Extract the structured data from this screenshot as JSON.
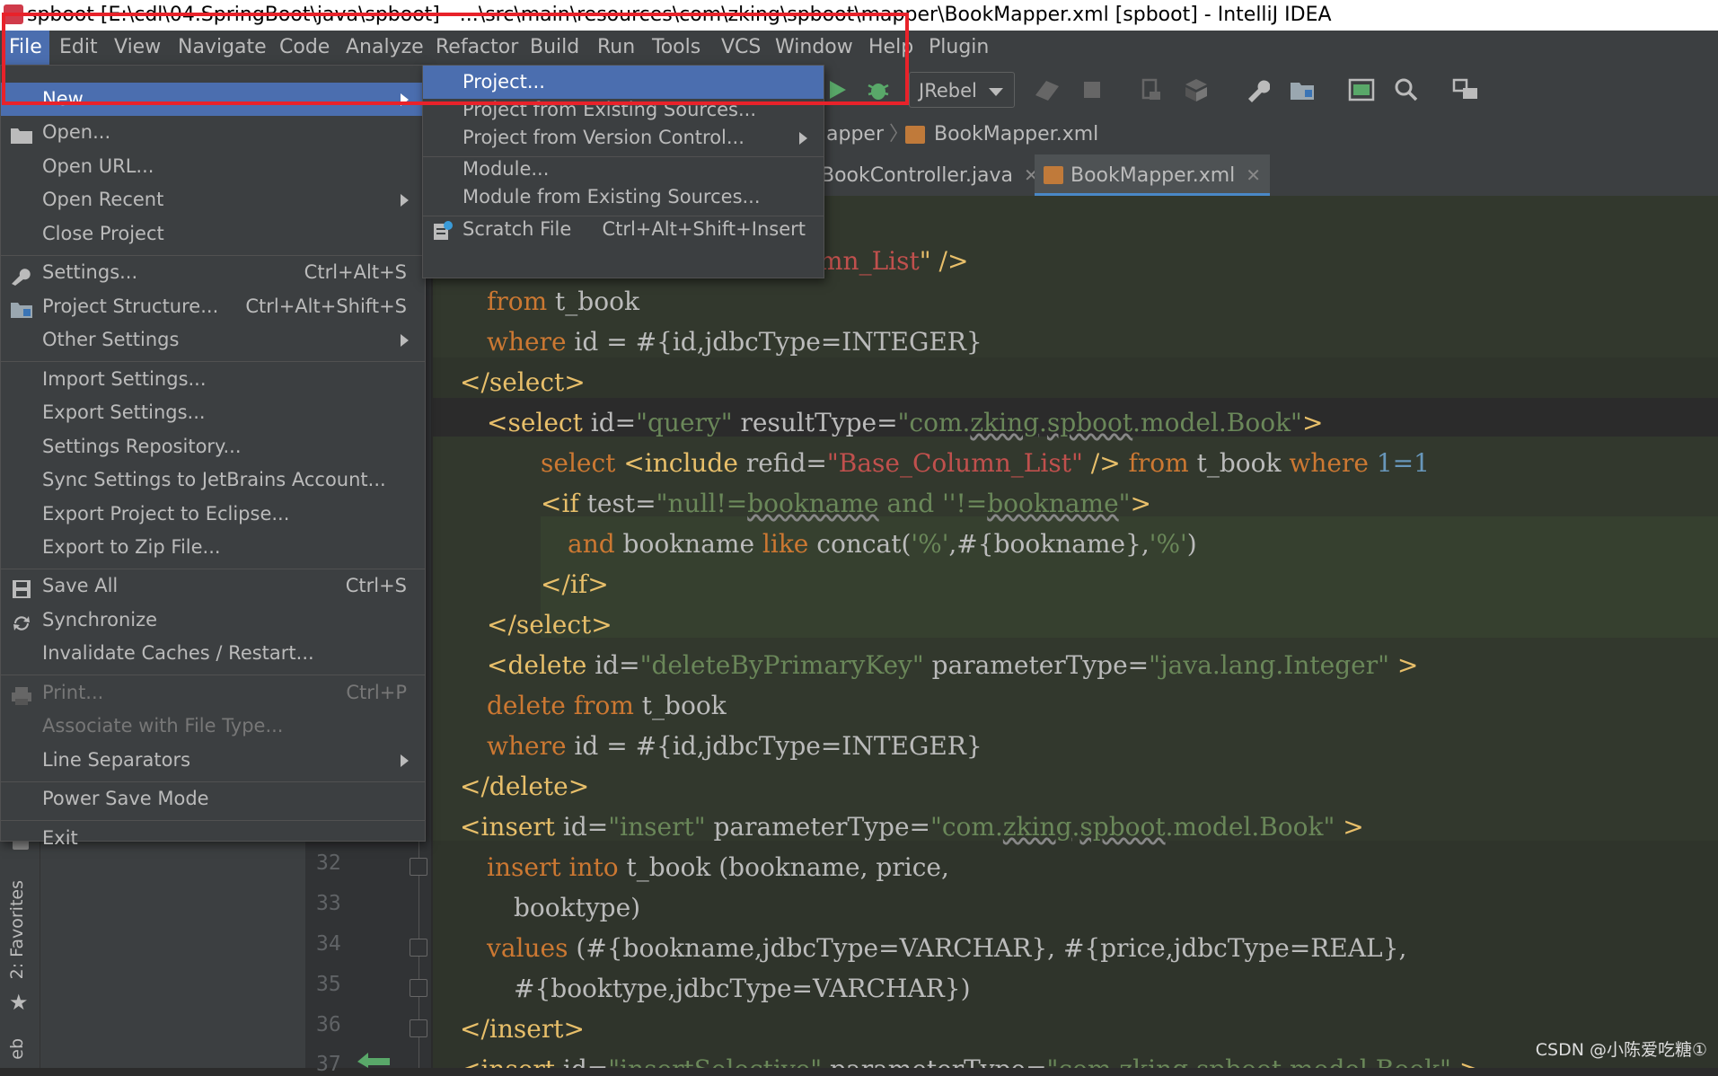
{
  "window": {
    "title": "spboot [E:\\cdl\\04.SpringBoot\\java\\spboot] - ...\\src\\main\\resources\\com\\zking\\spboot\\mapper\\BookMapper.xml [spboot] - IntelliJ IDEA"
  },
  "menubar": {
    "items": [
      "File",
      "Edit",
      "View",
      "Navigate",
      "Code",
      "Analyze",
      "Refactor",
      "Build",
      "Run",
      "Tools",
      "VCS",
      "Window",
      "Help",
      "Plugin"
    ]
  },
  "toolbar": {
    "run_config": "JRebel"
  },
  "breadcrumb": {
    "part1": "apper",
    "part2": "BookMapper.xml"
  },
  "tabs": [
    {
      "label": "BookController.java"
    },
    {
      "label": "BookMapper.xml"
    }
  ],
  "file_menu": {
    "items": [
      {
        "label": "New"
      },
      {
        "label": "Open..."
      },
      {
        "label": "Open URL..."
      },
      {
        "label": "Open Recent"
      },
      {
        "label": "Close Project"
      },
      {
        "label": "Settings...",
        "shortcut": "Ctrl+Alt+S"
      },
      {
        "label": "Project Structure...",
        "shortcut": "Ctrl+Alt+Shift+S"
      },
      {
        "label": "Other Settings"
      },
      {
        "label": "Import Settings..."
      },
      {
        "label": "Export Settings..."
      },
      {
        "label": "Settings Repository..."
      },
      {
        "label": "Sync Settings to JetBrains Account..."
      },
      {
        "label": "Export Project to Eclipse..."
      },
      {
        "label": "Export to Zip File..."
      },
      {
        "label": "Save All",
        "shortcut": "Ctrl+S"
      },
      {
        "label": "Synchronize"
      },
      {
        "label": "Invalidate Caches / Restart..."
      },
      {
        "label": "Print...",
        "shortcut": "Ctrl+P"
      },
      {
        "label": "Associate with File Type..."
      },
      {
        "label": "Line Separators"
      },
      {
        "label": "Power Save Mode"
      },
      {
        "label": "Exit"
      }
    ]
  },
  "new_submenu": {
    "items": [
      {
        "label": "Project..."
      },
      {
        "label": "Project from Existing Sources..."
      },
      {
        "label": "Project from Version Control..."
      },
      {
        "label": "Module..."
      },
      {
        "label": "Module from Existing Sources..."
      },
      {
        "label": "Scratch File",
        "shortcut": "Ctrl+Alt+Shift+Insert"
      }
    ]
  },
  "sidebar": {
    "favorites": "2: Favorites",
    "web": "eb"
  },
  "gutter": {
    "lines": [
      "32",
      "33",
      "34",
      "35",
      "36",
      "37"
    ]
  },
  "code": {
    "l1": [
      "mn_List",
      "\" />"
    ],
    "l2": [
      "from",
      " t_book"
    ],
    "l3": [
      "where",
      " id = #{id,jdbcType=INTEGER}"
    ],
    "l4": [
      "</select>"
    ],
    "l5": [
      "<select",
      " id=",
      "\"query\"",
      " resultType=",
      "\"com.",
      "zking",
      ".",
      "spboot",
      ".model.Book\"",
      ">"
    ],
    "l6": [
      "select",
      " ",
      "<include",
      " refid=",
      "\"Base_Column_List\"",
      " />",
      " from",
      " t_book ",
      "where",
      " 1=1"
    ],
    "l7": [
      "<if",
      " test=",
      "\"null!=",
      "bookname",
      " and ''!=",
      "bookname",
      "\"",
      ">"
    ],
    "l8": [
      "and",
      " bookname ",
      "like",
      " concat(",
      "'%'",
      ",#{bookname},",
      "'%'",
      ")"
    ],
    "l9": [
      "</if>"
    ],
    "l10": [
      "</select>"
    ],
    "l11": [
      "<delete",
      " id=",
      "\"deleteByPrimaryKey\"",
      " parameterType=",
      "\"java.lang.Integer\"",
      " >"
    ],
    "l12": [
      "delete",
      " ",
      "from",
      " t_book"
    ],
    "l13": [
      "where",
      " id = #{id,jdbcType=INTEGER}"
    ],
    "l14": [
      "</delete>"
    ],
    "l15": [
      "<insert",
      " id=",
      "\"insert\"",
      " parameterType=",
      "\"com.",
      "zking",
      ".",
      "spboot",
      ".model.Book\"",
      " >"
    ],
    "l16": [
      "insert",
      " ",
      "into",
      " t_book (bookname, price,"
    ],
    "l17": [
      "booktype)"
    ],
    "l18": [
      "values",
      " (#{bookname,jdbcType=VARCHAR}, #{price,jdbcType=REAL},"
    ],
    "l19": [
      "#{booktype,jdbcType=VARCHAR})"
    ],
    "l20": [
      "</insert>"
    ],
    "l21": [
      "<insert",
      " id=",
      "\"insertSelective\"",
      " parameterType=",
      "\"com.zking.spboot.model.Book\"",
      " >"
    ]
  },
  "watermark": "CSDN @小陈爱吃糖①",
  "colors": {
    "accent": "#4b6eaf",
    "highlight": "#e8222a"
  }
}
